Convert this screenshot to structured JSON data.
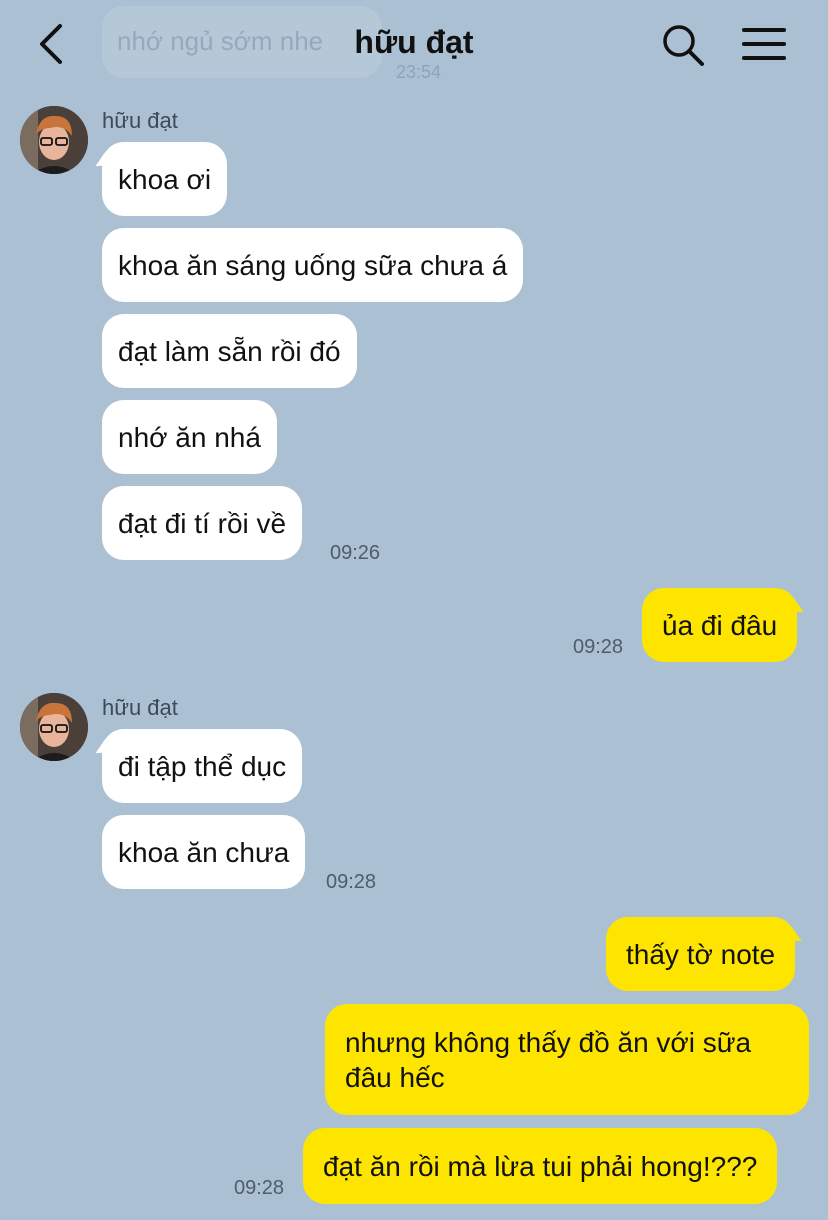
{
  "header": {
    "title": "hữu đạt",
    "back_icon": "chevron-left-icon",
    "search_icon": "search-icon",
    "menu_icon": "hamburger-menu-icon"
  },
  "previous_message": {
    "text": "nhớ ngủ sớm nhe",
    "time": "23:54"
  },
  "groups": [
    {
      "sender": "hữu đạt",
      "messages": [
        "khoa ơi",
        "khoa ăn sáng uống sữa chưa á",
        "đạt làm sẵn rồi đó",
        "nhớ ăn nhá",
        "đạt đi tí rồi về"
      ],
      "time": "09:26"
    },
    {
      "messages": [
        "ủa đi đâu"
      ],
      "time": "09:28"
    },
    {
      "sender": "hữu đạt",
      "messages": [
        "đi tập thể dục",
        "khoa ăn chưa"
      ],
      "time": "09:28"
    },
    {
      "messages": [
        "thấy tờ note",
        "nhưng không thấy đồ ăn với sữa đâu hếc",
        "đạt ăn rồi mà lừa tui phải hong!???"
      ],
      "time": "09:28"
    }
  ],
  "colors": {
    "background": "#abc1d3",
    "outgoing_bubble": "#fee500",
    "incoming_bubble": "#ffffff"
  }
}
